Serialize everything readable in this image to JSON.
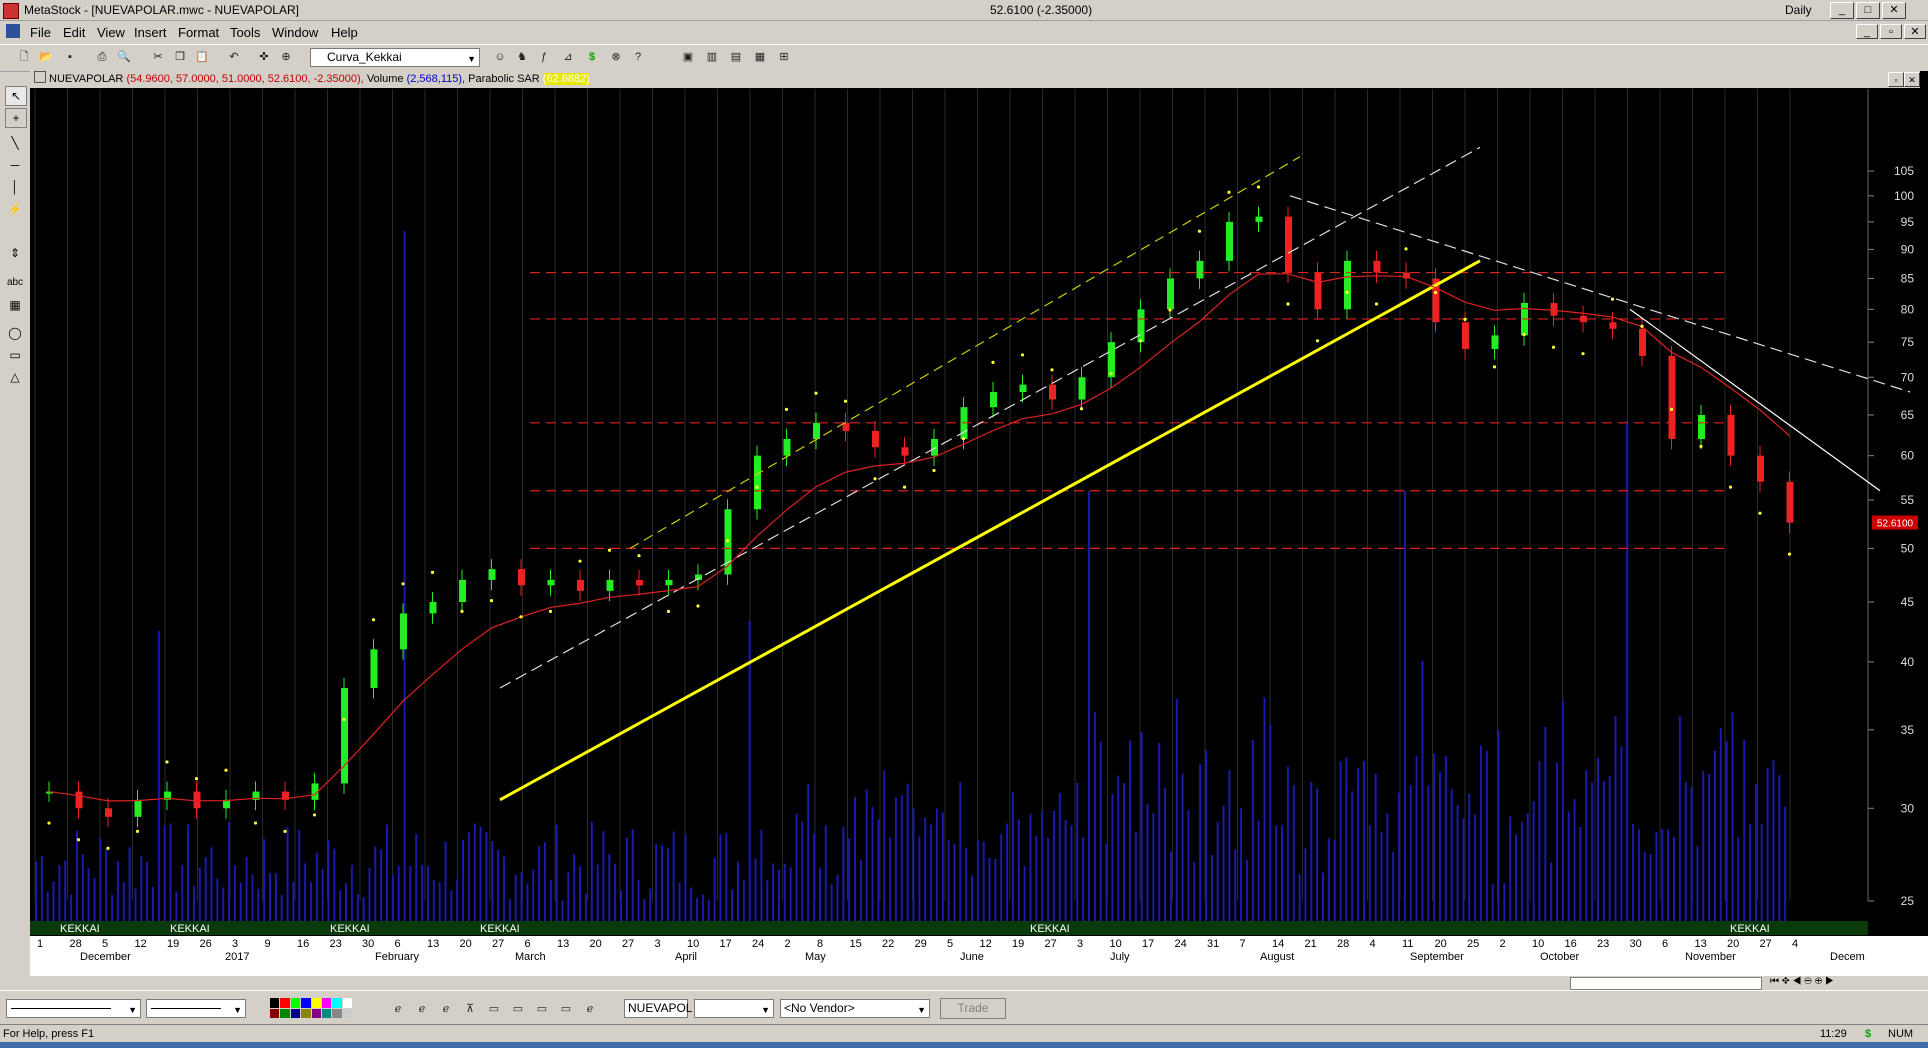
{
  "window": {
    "title": "MetaStock - [NUEVAPOLAR.mwc - NUEVAPOLAR]",
    "last_price_change": "52.6100 (-2.35000)",
    "periodicity": "Daily"
  },
  "menu": [
    "File",
    "Edit",
    "View",
    "Insert",
    "Format",
    "Tools",
    "Window",
    "Help"
  ],
  "toolbar": {
    "expert_combo": "Curva_Kekkai"
  },
  "chart_header": {
    "symbol": "NUEVAPOLAR",
    "ohlc": "(54.9600, 57.0000, 51.0000, 52.6100, -2.35000),",
    "volume_label": "Volume",
    "volume_value": "(2,568,115),",
    "sar_label": "Parabolic SAR",
    "sar_value": "(62.6882)"
  },
  "chart_data": {
    "type": "candlestick",
    "last_label": "52.6100",
    "y_axis_ticks": [
      105,
      100,
      95,
      90,
      85,
      80,
      75,
      70,
      65,
      60,
      55,
      50,
      45,
      40,
      35,
      30,
      25
    ],
    "x_axis_days": [
      "1",
      "28",
      "5",
      "12",
      "19",
      "26",
      "3",
      "9",
      "16",
      "23",
      "30",
      "6",
      "13",
      "20",
      "27",
      "6",
      "13",
      "20",
      "27",
      "3",
      "10",
      "17",
      "24",
      "2",
      "8",
      "15",
      "22",
      "29",
      "5",
      "12",
      "19",
      "27",
      "3",
      "10",
      "17",
      "24",
      "31",
      "7",
      "14",
      "21",
      "28",
      "4",
      "11",
      "20",
      "25",
      "2",
      "10",
      "16",
      "23",
      "30",
      "6",
      "13",
      "20",
      "27",
      "4"
    ],
    "x_axis_months": [
      "December",
      "2017",
      "February",
      "March",
      "April",
      "May",
      "June",
      "July",
      "August",
      "September",
      "October",
      "November",
      "Decem"
    ],
    "kekkai_labels": [
      "KEKKAI",
      "KEKKAI",
      "KEKKAI",
      "KEKKAI",
      "KEKKAI",
      "KEKKAI"
    ],
    "horizontal_levels": [
      86,
      78.5,
      64,
      56,
      50
    ],
    "trendline_support": {
      "from_price": 30.5,
      "to_price": 88
    },
    "close_path": [
      31,
      30,
      29.5,
      30.5,
      31,
      30,
      30.5,
      31,
      30.5,
      31.5,
      38,
      41,
      44,
      45,
      47,
      48,
      46.5,
      47,
      46,
      47,
      46.5,
      47,
      47.5,
      54,
      60,
      62,
      64,
      63,
      61,
      60,
      62,
      66,
      68,
      69,
      67,
      70,
      75,
      80,
      85,
      88,
      95,
      96,
      86,
      80,
      88,
      86,
      85,
      78,
      74,
      76,
      81,
      79,
      78,
      77,
      73,
      62,
      65,
      60,
      57,
      52.6
    ]
  },
  "bottom": {
    "symbol_box": "NUEVAPOL",
    "vendor": "<No Vendor>",
    "trade": "Trade"
  },
  "status": {
    "help": "For Help, press F1",
    "time": "11:29",
    "num": "NUM"
  }
}
